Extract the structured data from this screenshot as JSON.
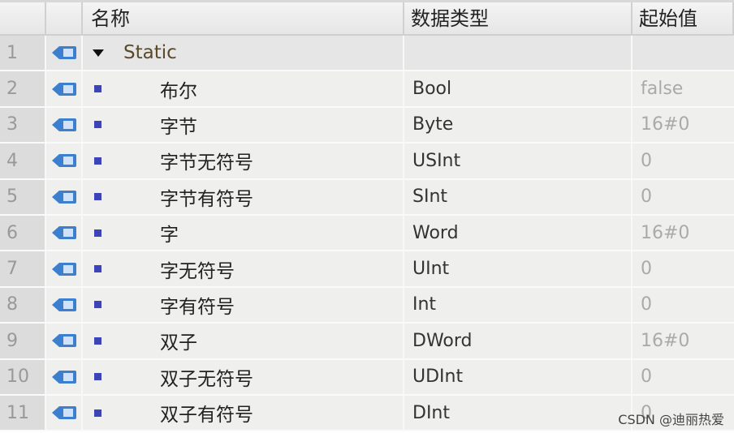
{
  "header": {
    "name": "名称",
    "type": "数据类型",
    "start": "起始值"
  },
  "rows": [
    {
      "num": "1",
      "name": "Static",
      "type": "",
      "start": ""
    },
    {
      "num": "2",
      "name": "布尔",
      "type": "Bool",
      "start": "false"
    },
    {
      "num": "3",
      "name": "字节",
      "type": "Byte",
      "start": "16#0"
    },
    {
      "num": "4",
      "name": "字节无符号",
      "type": "USInt",
      "start": "0"
    },
    {
      "num": "5",
      "name": "字节有符号",
      "type": "SInt",
      "start": "0"
    },
    {
      "num": "6",
      "name": "字",
      "type": "Word",
      "start": "16#0"
    },
    {
      "num": "7",
      "name": "字无符号",
      "type": "UInt",
      "start": "0"
    },
    {
      "num": "8",
      "name": "字有符号",
      "type": "Int",
      "start": "0"
    },
    {
      "num": "9",
      "name": "双子",
      "type": "DWord",
      "start": "16#0"
    },
    {
      "num": "10",
      "name": "双子无符号",
      "type": "UDInt",
      "start": "0"
    },
    {
      "num": "11",
      "name": "双子有符号",
      "type": "DInt",
      "start": "0"
    }
  ],
  "watermark": "CSDN @迪丽热爱",
  "icons": {
    "row_icon": "static-variable-tag-icon",
    "expand": "triangle-down-icon",
    "item": "square-bullet-icon"
  }
}
